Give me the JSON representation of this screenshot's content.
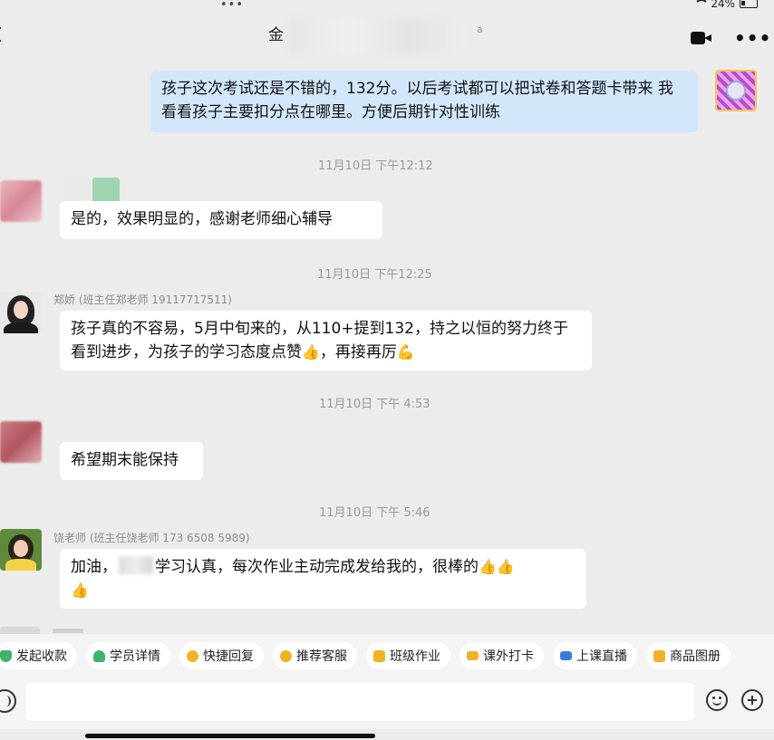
{
  "status_bar": {
    "dots": "•••",
    "battery": "24%"
  },
  "header": {
    "title": "金",
    "title_suffix": "a"
  },
  "messages": [
    {
      "text": "孩子这次考试还是不错的，132分。以后考试都可以把试卷和答题卡带来 我看看孩子主要扣分点在哪里。方便后期针对性训练"
    },
    {
      "time": "11月10日 下午12:12",
      "text": "是的，效果明显的，感谢老师细心辅导"
    },
    {
      "time": "11月10日 下午12:25",
      "sender": "郑娇 (班主任郑老师 19117717511)",
      "text": "孩子真的不容易，5月中旬来的，从110+提到132，持之以恒的努力终于看到进步，为孩子的学习态度点赞",
      "text_end": "，再接再厉"
    },
    {
      "time": "11月10日 下午 4:53",
      "text": "希望期末能保持"
    },
    {
      "time": "11月10日 下午 5:46",
      "sender": "饶老师 (班主任饶老师 173 6508 5989)",
      "text_start": "加油，",
      "text_mid": "学习认真，每次作业主动完成发给我的，很棒的"
    }
  ],
  "emoji": {
    "thumbs": "👍",
    "flex": "💪"
  },
  "toolbar": [
    {
      "label": "发起收款",
      "icon": "shield-icon"
    },
    {
      "label": "学员详情",
      "icon": "person-icon"
    },
    {
      "label": "快捷回复",
      "icon": "chat-bubble-icon"
    },
    {
      "label": "推荐客服",
      "icon": "smile-icon"
    },
    {
      "label": "班级作业",
      "icon": "document-icon"
    },
    {
      "label": "课外打卡",
      "icon": "card-icon"
    },
    {
      "label": "上课直播",
      "icon": "live-icon"
    },
    {
      "label": "商品图册",
      "icon": "bag-icon"
    }
  ],
  "input": {
    "placeholder": ""
  },
  "colors": {
    "background": "#ececec",
    "outgoing_bubble": "#d2e7fa",
    "incoming_bubble": "#ffffff",
    "timestamp": "#9a9a9a",
    "accent_green": "#3fb36b",
    "accent_yellow": "#f0b323"
  }
}
